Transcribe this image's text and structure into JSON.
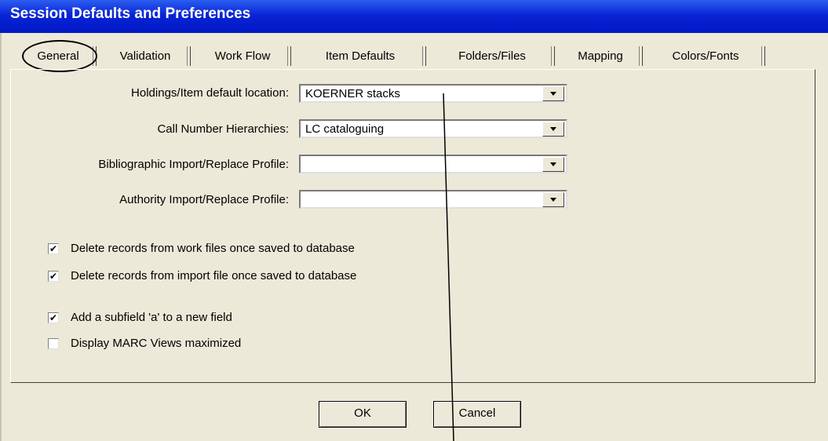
{
  "window": {
    "title": "Session Defaults and Preferences"
  },
  "tabs": [
    {
      "label": "General",
      "active": true
    },
    {
      "label": "Validation",
      "active": false
    },
    {
      "label": "Work Flow",
      "active": false
    },
    {
      "label": "Item Defaults",
      "active": false
    },
    {
      "label": "Folders/Files",
      "active": false
    },
    {
      "label": "Mapping",
      "active": false
    },
    {
      "label": "Colors/Fonts",
      "active": false
    }
  ],
  "fields": [
    {
      "label": "Holdings/Item default location:",
      "value": "KOERNER stacks"
    },
    {
      "label": "Call Number Hierarchies:",
      "value": "LC cataloguing"
    },
    {
      "label": "Bibliographic Import/Replace Profile:",
      "value": ""
    },
    {
      "label": "Authority Import/Replace Profile:",
      "value": ""
    }
  ],
  "options": [
    {
      "label": "Delete records from work files once saved to database",
      "checked": true
    },
    {
      "label": "Delete records from import file once saved to database",
      "checked": true
    },
    {
      "label": "Add a subfield 'a' to a new field",
      "checked": true
    },
    {
      "label": "Display MARC Views maximized",
      "checked": false
    }
  ],
  "buttons": {
    "ok_label": "OK",
    "cancel_label": "Cancel"
  },
  "icons": {
    "dropdown": "chevron-down-icon",
    "check": "checkmark-icon"
  },
  "colors": {
    "titlebar": "#0a24d6",
    "window_bg": "#ece9d8"
  }
}
